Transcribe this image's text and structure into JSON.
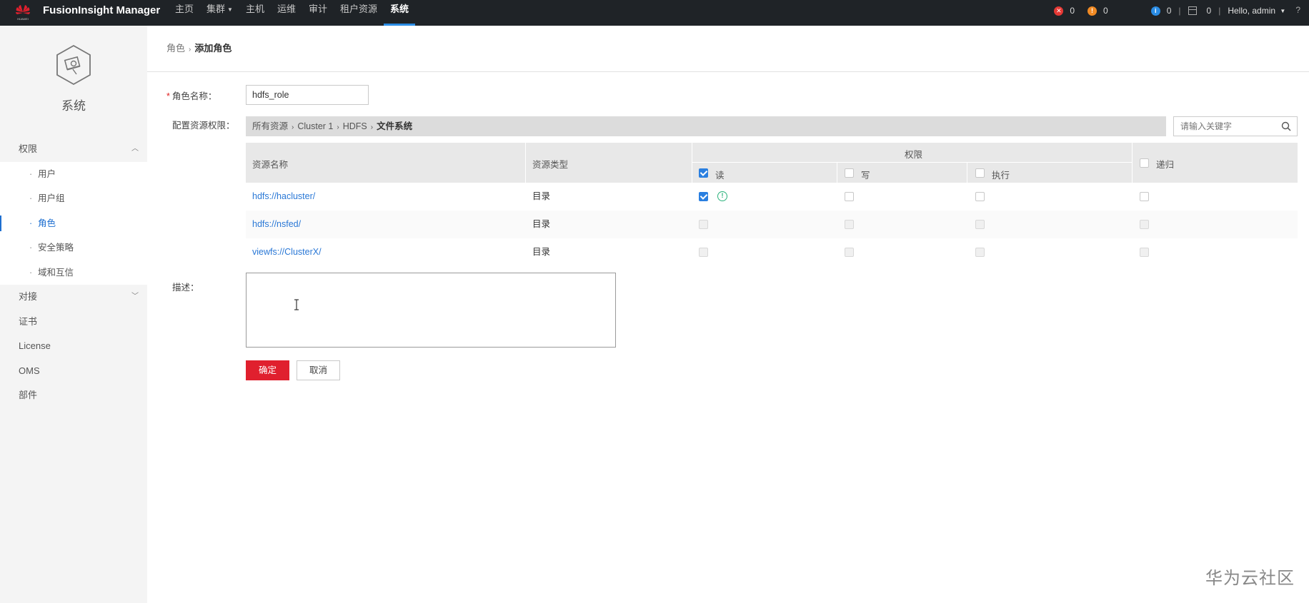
{
  "app": {
    "title": "FusionInsight Manager"
  },
  "nav": [
    {
      "label": "主页"
    },
    {
      "label": "集群",
      "dropdown": true
    },
    {
      "label": "主机"
    },
    {
      "label": "运维"
    },
    {
      "label": "审计"
    },
    {
      "label": "租户资源"
    },
    {
      "label": "系统",
      "active": true
    }
  ],
  "topbar": {
    "alarm_critical": "0",
    "alarm_major": "0",
    "info_count": "0",
    "task_count": "0",
    "separator": "|",
    "user_greeting": "Hello, admin",
    "help": "?"
  },
  "sidebar": {
    "title": "系统",
    "groups": [
      {
        "label": "权限",
        "expanded": true,
        "items": [
          "用户",
          "用户组",
          "角色",
          "安全策略",
          "域和互信"
        ],
        "active_item": "角色"
      },
      {
        "label": "对接",
        "expanded": false
      },
      {
        "label": "证书"
      },
      {
        "label": "License"
      },
      {
        "label": "OMS"
      },
      {
        "label": "部件"
      }
    ]
  },
  "breadcrumb": {
    "parent": "角色",
    "current": "添加角色",
    "sep": "›"
  },
  "form": {
    "role_name_label": "角色名称：",
    "role_name_required": "*",
    "role_name_value": "hdfs_role",
    "res_perm_label": "配置资源权限：",
    "res_path": {
      "root": "所有资源",
      "cluster": "Cluster 1",
      "service": "HDFS",
      "current": "文件系统",
      "sep": "›"
    },
    "search_placeholder": "请输入关键字",
    "desc_label": "描述：",
    "desc_value": "",
    "ok_label": "确定",
    "cancel_label": "取消"
  },
  "table": {
    "headers": {
      "name": "资源名称",
      "type": "资源类型",
      "perm": "权限",
      "read": "读",
      "write": "写",
      "exec": "执行",
      "recursive": "递归"
    },
    "header_read_checked": true,
    "rows": [
      {
        "name": "hdfs://hacluster/",
        "type": "目录",
        "read": true,
        "write": false,
        "exec": false,
        "recursive": false,
        "enabled": true
      },
      {
        "name": "hdfs://nsfed/",
        "type": "目录",
        "read": false,
        "write": false,
        "exec": false,
        "recursive": false,
        "enabled": false
      },
      {
        "name": "viewfs://ClusterX/",
        "type": "目录",
        "read": false,
        "write": false,
        "exec": false,
        "recursive": false,
        "enabled": false
      }
    ]
  },
  "watermark": "华为云社区",
  "colors": {
    "topbar": "#1f2327",
    "accent": "#2a8ce4",
    "primary_button": "#e0202e",
    "link": "#2a78d6"
  }
}
